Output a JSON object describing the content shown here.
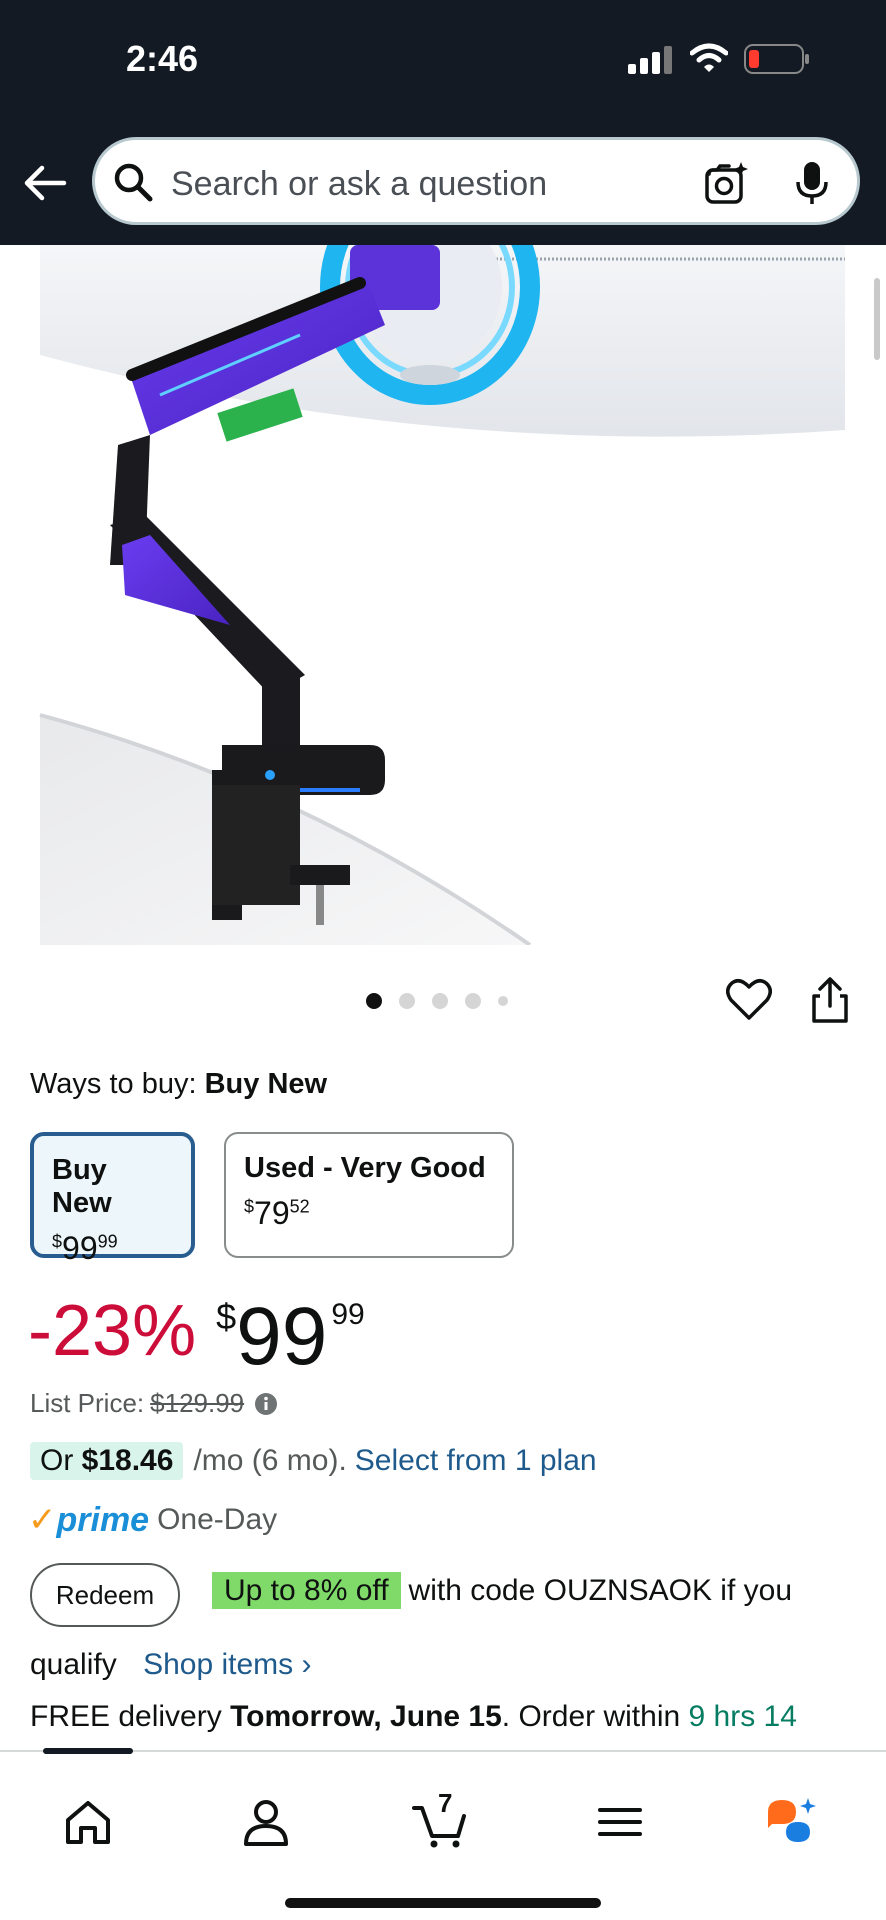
{
  "status": {
    "time": "2:46"
  },
  "search": {
    "placeholder": "Search or ask a question"
  },
  "gallery": {
    "dot_count": 5,
    "active_index": 0
  },
  "ways_to_buy": {
    "label": "Ways to buy:",
    "selected": "Buy New"
  },
  "options": [
    {
      "title": "Buy New",
      "currency": "$",
      "whole": "99",
      "fraction": "99",
      "selected": true
    },
    {
      "title": "Used - Very Good",
      "currency": "$",
      "whole": "79",
      "fraction": "52",
      "selected": false
    }
  ],
  "price": {
    "discount": "-23%",
    "currency": "$",
    "whole": "99",
    "fraction": "99"
  },
  "list_price": {
    "label": "List Price:",
    "value": "$129.99"
  },
  "monthly": {
    "prefix": "Or",
    "amount": "$18.46",
    "suffix": "/mo (6 mo).",
    "link": "Select from 1 plan"
  },
  "prime": {
    "check": "✓",
    "word": "prime",
    "label": "One-Day"
  },
  "coupon": {
    "button": "Redeem",
    "badge": "Up to 8% off",
    "text": "with code OUZNSAOK if you",
    "text2": "qualify",
    "link": "Shop items ›"
  },
  "delivery": {
    "prefix": "FREE delivery",
    "date": "Tomorrow, June 15",
    "mid": ". Order within",
    "countdown": "9 hrs 14"
  },
  "nav": {
    "cart_count": "7"
  },
  "colors": {
    "header_bg": "#131a24",
    "discount": "#cc0c39",
    "link": "#1e5a8c",
    "coupon_badge": "#7fda69",
    "prime": "#1a8fd8",
    "countdown": "#067d62"
  }
}
